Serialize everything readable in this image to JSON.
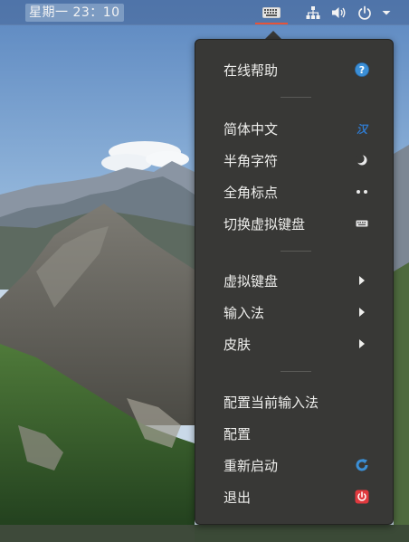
{
  "topbar": {
    "clock_text": "星期一 23：10",
    "icons": [
      "keyboard-icon",
      "network-icon",
      "volume-icon",
      "power-icon",
      "dropdown-arrow-icon"
    ]
  },
  "menu": {
    "items": [
      {
        "label": "在线帮助",
        "icon": "help-icon"
      },
      {
        "label": "简体中文",
        "icon": "simplified-chinese-icon",
        "icon_text": "汉"
      },
      {
        "label": "半角字符",
        "icon": "half-width-moon-icon"
      },
      {
        "label": "全角标点",
        "icon": "full-width-punctuation-icon"
      },
      {
        "label": "切换虚拟键盘",
        "icon": "keyboard-icon"
      },
      {
        "label": "虚拟键盘",
        "icon": "submenu-arrow-icon"
      },
      {
        "label": "输入法",
        "icon": "submenu-arrow-icon"
      },
      {
        "label": "皮肤",
        "icon": "submenu-arrow-icon"
      },
      {
        "label": "配置当前输入法"
      },
      {
        "label": "配置"
      },
      {
        "label": "重新启动",
        "icon": "restart-icon"
      },
      {
        "label": "退出",
        "icon": "exit-icon"
      }
    ]
  },
  "colors": {
    "menu_bg": "#383836",
    "accent_red": "#e5543a",
    "help_blue": "#3b8fd6"
  }
}
